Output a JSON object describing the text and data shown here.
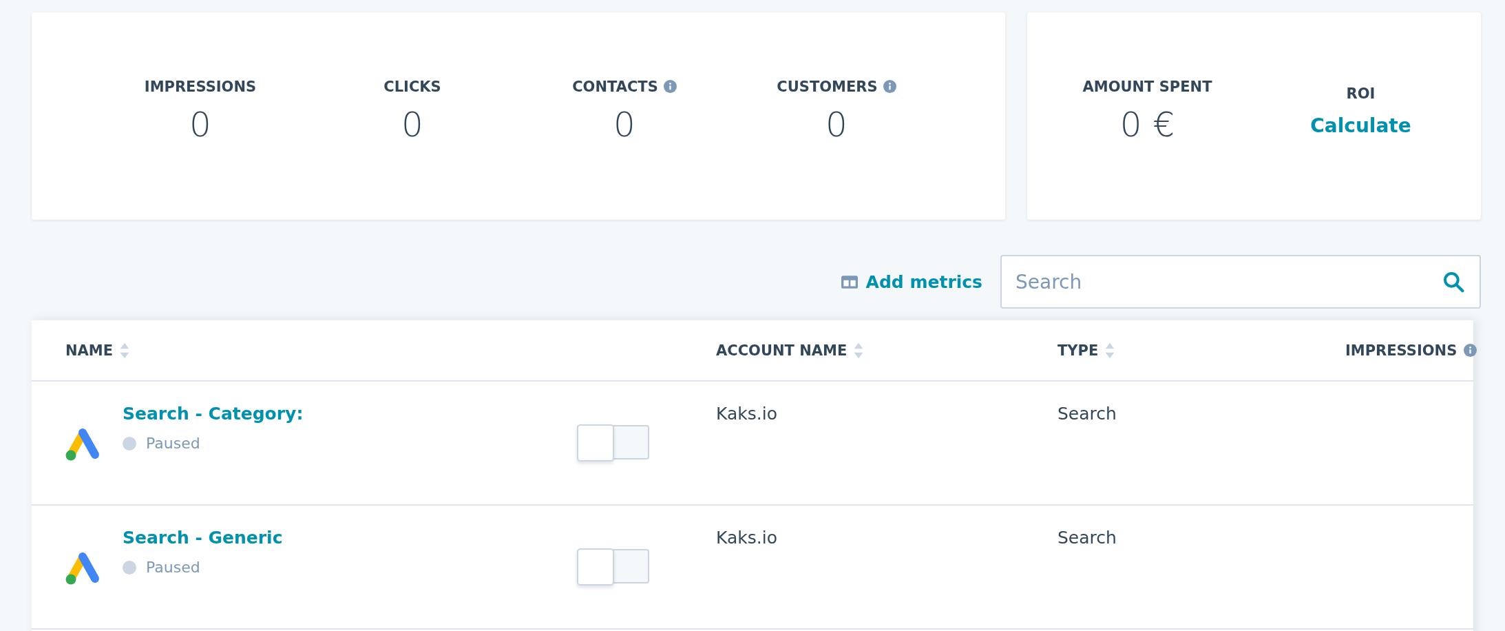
{
  "summary_card": {
    "metrics": [
      {
        "label": "IMPRESSIONS",
        "value": "0",
        "info": false
      },
      {
        "label": "CLICKS",
        "value": "0",
        "info": false
      },
      {
        "label": "CONTACTS",
        "value": "0",
        "info": true
      },
      {
        "label": "CUSTOMERS",
        "value": "0",
        "info": true
      }
    ]
  },
  "spend_card": {
    "amount_label": "AMOUNT SPENT",
    "amount": "0 €",
    "roi_label": "ROI",
    "roi_link": "Calculate"
  },
  "toolbar": {
    "add_metrics": "Add metrics",
    "search": {
      "placeholder": "Search"
    }
  },
  "table": {
    "columns": [
      {
        "label": "NAME",
        "sortable": true,
        "info": false
      },
      {
        "label": "ACCOUNT NAME",
        "sortable": true,
        "info": false
      },
      {
        "label": "TYPE",
        "sortable": true,
        "info": false
      },
      {
        "label": "IMPRESSIONS",
        "sortable": false,
        "info": true
      }
    ],
    "rows": [
      {
        "name": "Search - Category:",
        "status": "Paused",
        "on": false,
        "account": "Kaks.io",
        "type": "Search"
      },
      {
        "name": "Search - Generic",
        "status": "Paused",
        "on": false,
        "account": "Kaks.io",
        "type": "Search"
      }
    ]
  }
}
